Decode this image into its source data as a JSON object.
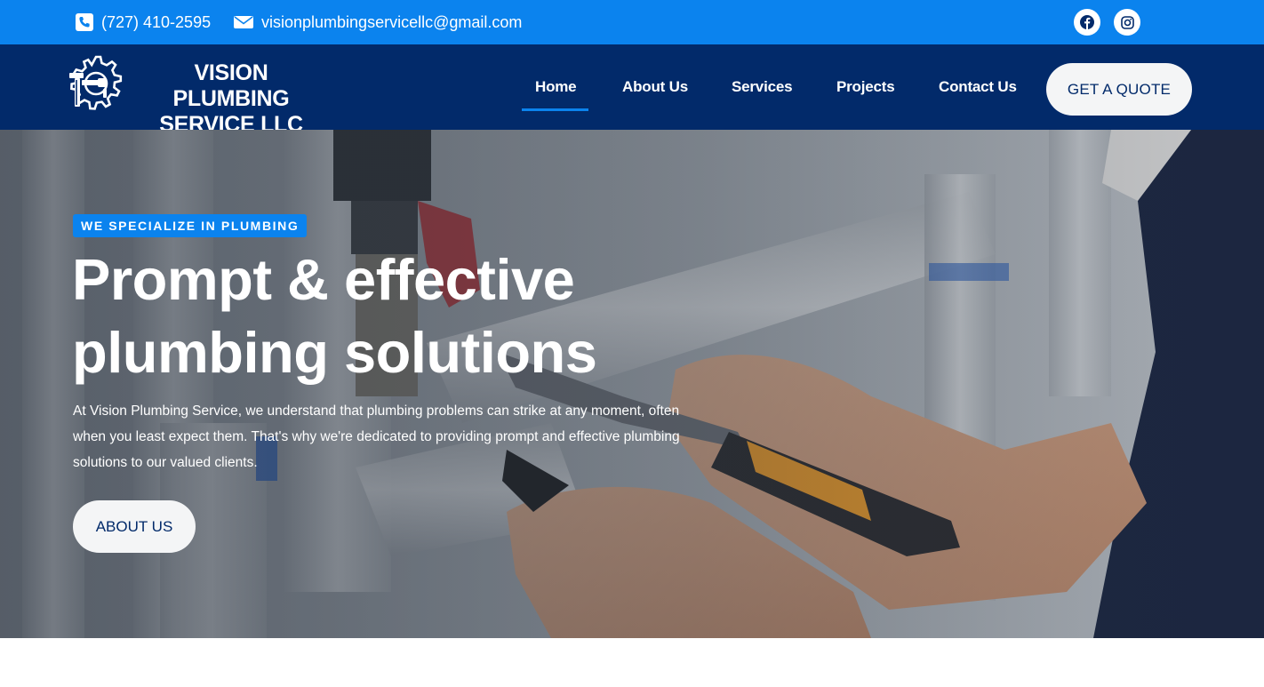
{
  "topbar": {
    "phone": "(727) 410-2595",
    "email": "visionplumbingservicellc@gmail.com",
    "social": [
      "facebook-icon",
      "instagram-icon"
    ]
  },
  "header": {
    "logo_line1": "VISION PLUMBING",
    "logo_line2": "SERVICE LLC",
    "nav": [
      "Home",
      "About Us",
      "Services",
      "Projects",
      "Contact Us"
    ],
    "active_nav": "Home",
    "cta": "GET A QUOTE"
  },
  "hero": {
    "tag": "WE SPECIALIZE IN PLUMBING",
    "headline_line1": "Prompt & effective",
    "headline_line2": "plumbing solutions",
    "paragraph": "At Vision Plumbing Service, we understand that plumbing problems can strike at any moment, often when you least expect them. That's why we're dedicated to providing prompt and effective plumbing solutions to our valued clients.",
    "button": "ABOUT US"
  },
  "colors": {
    "topbar": "#0b83ee",
    "header": "#022a6a",
    "accent": "#0b83ee",
    "button_bg": "#f4f5f6",
    "button_text": "#022a6a"
  }
}
